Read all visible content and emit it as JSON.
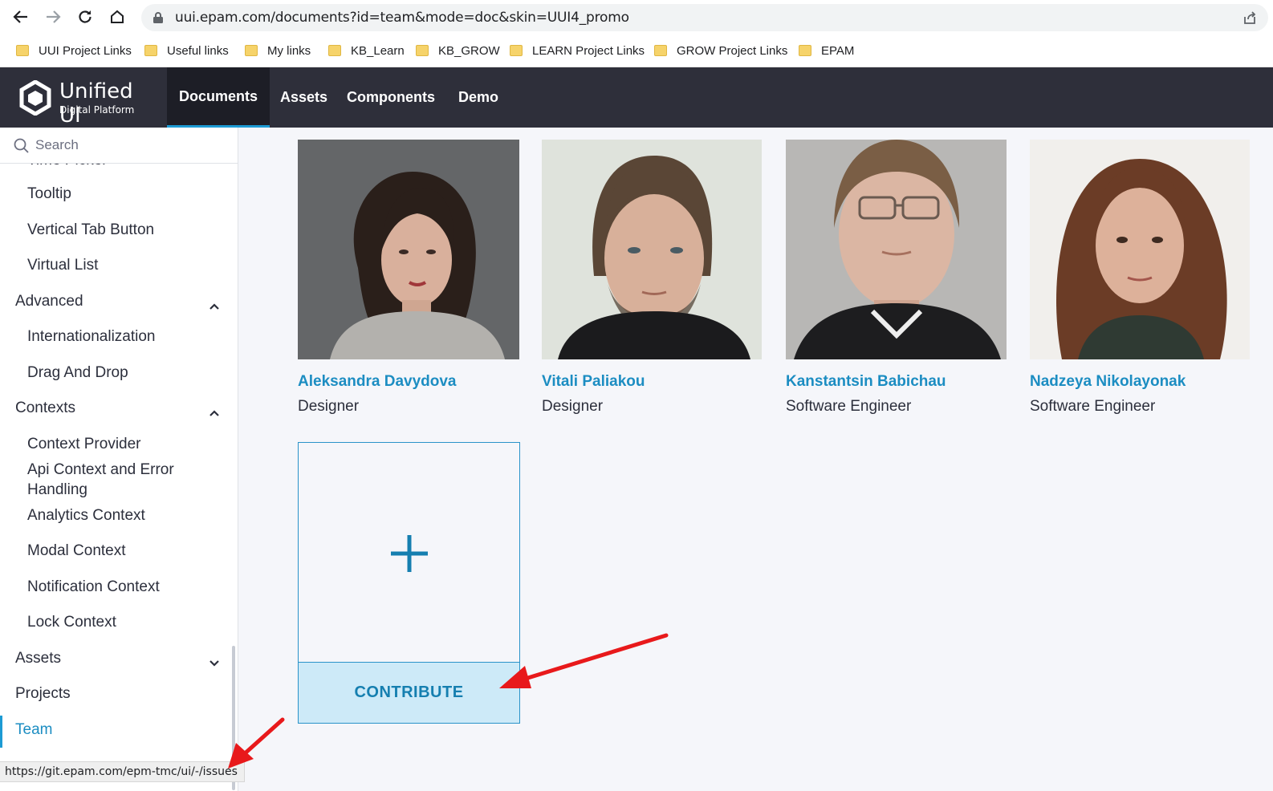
{
  "browser": {
    "url": "uui.epam.com/documents?id=team&mode=doc&skin=UUI4_promo",
    "bookmarks": [
      "UUI Project Links",
      "Useful links",
      "My links",
      "KB_Learn",
      "KB_GROW",
      "LEARN Project Links",
      "GROW Project Links",
      "EPAM"
    ],
    "status_url": "https://git.epam.com/epm-tmc/ui/-/issues"
  },
  "app": {
    "logo_title": "Unified UI",
    "logo_subtitle": "Digital Platform",
    "tabs": [
      "Documents",
      "Assets",
      "Components",
      "Demo"
    ],
    "active_tab": "Documents"
  },
  "sidebar": {
    "search_placeholder": "Search",
    "cut_item": "Time Picker",
    "items": [
      {
        "label": "Tooltip",
        "level": "child"
      },
      {
        "label": "Vertical Tab Button",
        "level": "child"
      },
      {
        "label": "Virtual List",
        "level": "child"
      },
      {
        "label": "Advanced",
        "level": "parent",
        "expanded": true
      },
      {
        "label": "Internationalization",
        "level": "child"
      },
      {
        "label": "Drag And Drop",
        "level": "child"
      },
      {
        "label": "Contexts",
        "level": "parent",
        "expanded": true
      },
      {
        "label": "Context Provider",
        "level": "child"
      },
      {
        "label": "Api Context and Error",
        "level": "child"
      },
      {
        "label": "Handling",
        "level": "child"
      },
      {
        "label": "Analytics Context",
        "level": "child"
      },
      {
        "label": "Modal Context",
        "level": "child"
      },
      {
        "label": "Notification Context",
        "level": "child"
      },
      {
        "label": "Lock Context",
        "level": "child"
      },
      {
        "label": "Assets",
        "level": "parent",
        "expanded": false
      },
      {
        "label": "Projects",
        "level": "parent"
      },
      {
        "label": "Team",
        "level": "parent",
        "active": true
      }
    ]
  },
  "team": {
    "members": [
      {
        "name": "Aleksandra Davydova",
        "role": "Designer"
      },
      {
        "name": "Vitali Paliakou",
        "role": "Designer"
      },
      {
        "name": "Kanstantsin Babichau",
        "role": "Software Engineer"
      },
      {
        "name": "Nadzeya Nikolayonak",
        "role": "Software Engineer"
      }
    ],
    "contribute_label": "CONTRIBUTE"
  },
  "colors": {
    "header_bg": "#2e2f3a",
    "accent": "#1d9bd4",
    "link": "#1c8dc2",
    "contribute_bg": "#cdeaf8",
    "annotation_arrow": "#e8191b"
  }
}
